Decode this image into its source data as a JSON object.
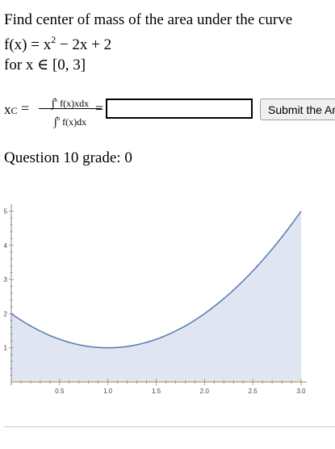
{
  "problem": {
    "line1": "Find center of mass of the area under the curve",
    "line2_prefix": "f(x) = x",
    "line2_exp": "2",
    "line2_suffix": " − 2x + 2",
    "line3": "for x ∈ [0, 3]"
  },
  "formula": {
    "lhs": "x",
    "lhs_sub": "C",
    "equals": "=",
    "numerator": "f(x)xdx",
    "denominator": "f(x)dx",
    "integral_symbol": "∫",
    "upper_limit": "b",
    "lower_limit": "a"
  },
  "answer": {
    "value": "",
    "placeholder": ""
  },
  "submit": {
    "label": "Submit the Answer"
  },
  "grade": {
    "text": "Question 10 grade: 0"
  },
  "chart_data": {
    "type": "area",
    "function": "x^2 - 2x + 2",
    "x": [
      0,
      0.25,
      0.5,
      0.75,
      1.0,
      1.25,
      1.5,
      1.75,
      2.0,
      2.25,
      2.5,
      2.75,
      3.0
    ],
    "y": [
      2,
      1.5625,
      1.25,
      1.0625,
      1,
      1.0625,
      1.25,
      1.5625,
      2,
      2.5625,
      3.25,
      4.0625,
      5
    ],
    "xlim": [
      0,
      3.05
    ],
    "ylim": [
      0,
      5.2
    ],
    "x_ticks": [
      "0.5",
      "1.0",
      "1.5",
      "2.0",
      "2.5",
      "3.0"
    ],
    "y_ticks": [
      "1",
      "2",
      "3",
      "4",
      "5"
    ],
    "colors": {
      "line": "#5b7fb5",
      "fill": "#dfe6f2",
      "x_axis": "#c08040"
    },
    "grid": false
  }
}
